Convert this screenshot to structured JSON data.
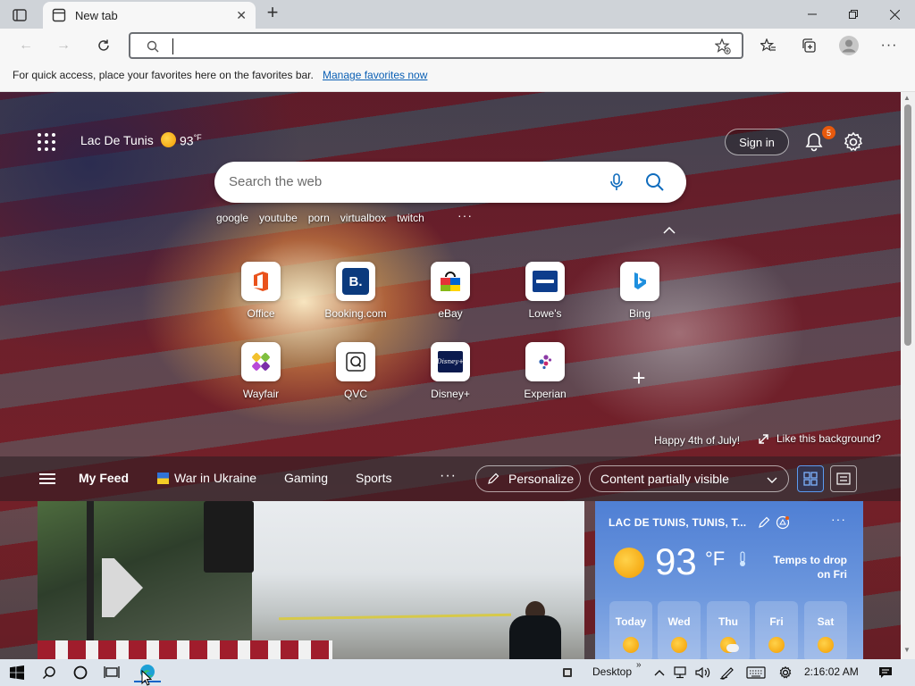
{
  "browser": {
    "tab_title": "New tab",
    "address_value": "",
    "favorites_message": "For quick access, place your favorites here on the favorites bar.",
    "favorites_link": "Manage favorites now"
  },
  "ntp": {
    "location": "Lac De Tunis",
    "temperature": "93",
    "temp_unit": "°F",
    "sign_in": "Sign in",
    "notification_count": "5",
    "search_placeholder": "Search the web",
    "trending": [
      "google",
      "youtube",
      "porn",
      "virtualbox",
      "twitch"
    ],
    "quick_links": [
      {
        "label": "Office",
        "icon": "office-icon"
      },
      {
        "label": "Booking.com",
        "icon": "booking-icon"
      },
      {
        "label": "eBay",
        "icon": "ebay-icon"
      },
      {
        "label": "Lowe's",
        "icon": "lowes-icon"
      },
      {
        "label": "Bing",
        "icon": "bing-icon"
      },
      {
        "label": "Wayfair",
        "icon": "wayfair-icon"
      },
      {
        "label": "QVC",
        "icon": "qvc-icon"
      },
      {
        "label": "Disney+",
        "icon": "disney-icon"
      },
      {
        "label": "Experian",
        "icon": "experian-icon"
      }
    ],
    "background_caption": "Happy 4th of July!",
    "like_background": "Like this background?"
  },
  "feed": {
    "tabs": [
      "My Feed",
      "War in Ukraine",
      "Gaming",
      "Sports"
    ],
    "personalize": "Personalize",
    "content_visibility": "Content partially visible"
  },
  "weather": {
    "location": "LAC DE TUNIS, TUNIS, T...",
    "temperature": "93",
    "unit": "°F",
    "message": "Temps to drop on Fri",
    "days": [
      "Today",
      "Wed",
      "Thu",
      "Fri",
      "Sat"
    ]
  },
  "taskbar": {
    "desktop_label": "Desktop",
    "time": "2:16:02 AM"
  },
  "colors": {
    "accent_blue": "#0a5fb4",
    "badge_orange": "#e8590c",
    "weather_blue": "#4f7fd4",
    "taskbar": "#dde4ec"
  }
}
